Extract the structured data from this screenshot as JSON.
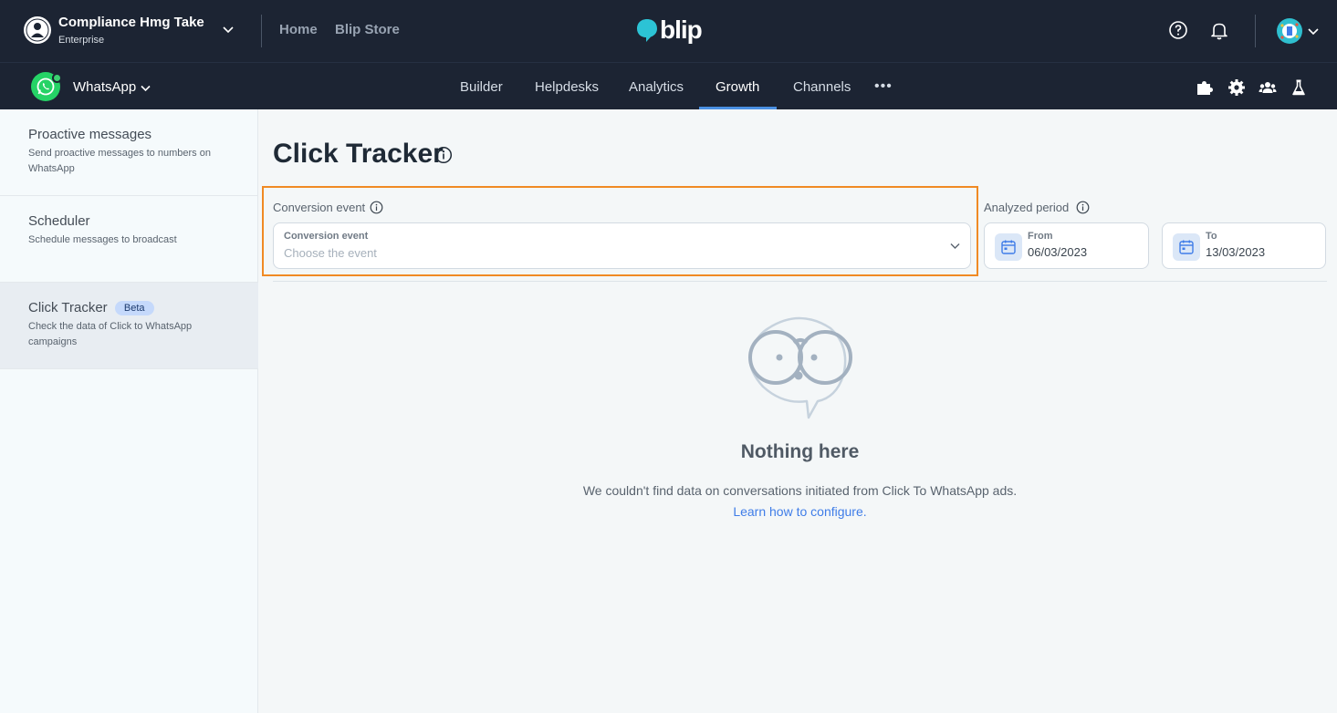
{
  "header": {
    "org_name": "Compliance Hmg Take",
    "org_plan": "Enterprise",
    "links": [
      "Home",
      "Blip Store"
    ],
    "logo_text": "blip",
    "icons": [
      "help-icon",
      "bell-icon",
      "user-avatar",
      "chevron-down-icon"
    ]
  },
  "subnav": {
    "channel": "WhatsApp",
    "tabs": [
      "Builder",
      "Helpdesks",
      "Analytics",
      "Growth",
      "Channels"
    ],
    "active_tab": "Growth",
    "more": "•••",
    "right_icons": [
      "puzzle-icon",
      "gear-icon",
      "team-icon",
      "flask-icon"
    ]
  },
  "sidebar": {
    "items": [
      {
        "title": "Proactive messages",
        "desc": "Send proactive messages to numbers on WhatsApp"
      },
      {
        "title": "Scheduler",
        "desc": "Schedule messages to broadcast"
      },
      {
        "title": "Click Tracker",
        "badge": "Beta",
        "desc": "Check the data of Click to WhatsApp campaigns"
      }
    ],
    "active_index": 2
  },
  "main": {
    "title": "Click Tracker",
    "conversion": {
      "label": "Conversion event",
      "field_label": "Conversion event",
      "placeholder": "Choose the event"
    },
    "period": {
      "label": "Analyzed period",
      "from_label": "From",
      "from_value": "06/03/2023",
      "to_label": "To",
      "to_value": "13/03/2023"
    },
    "empty": {
      "title": "Nothing here",
      "description": "We couldn't find data on conversations initiated from Click To WhatsApp ads.",
      "link": "Learn how to configure."
    }
  },
  "colors": {
    "topbar": "#1c2433",
    "accent": "#4a90e2",
    "highlight": "#f08a24",
    "link": "#3f7de8",
    "whatsapp": "#25d366"
  }
}
